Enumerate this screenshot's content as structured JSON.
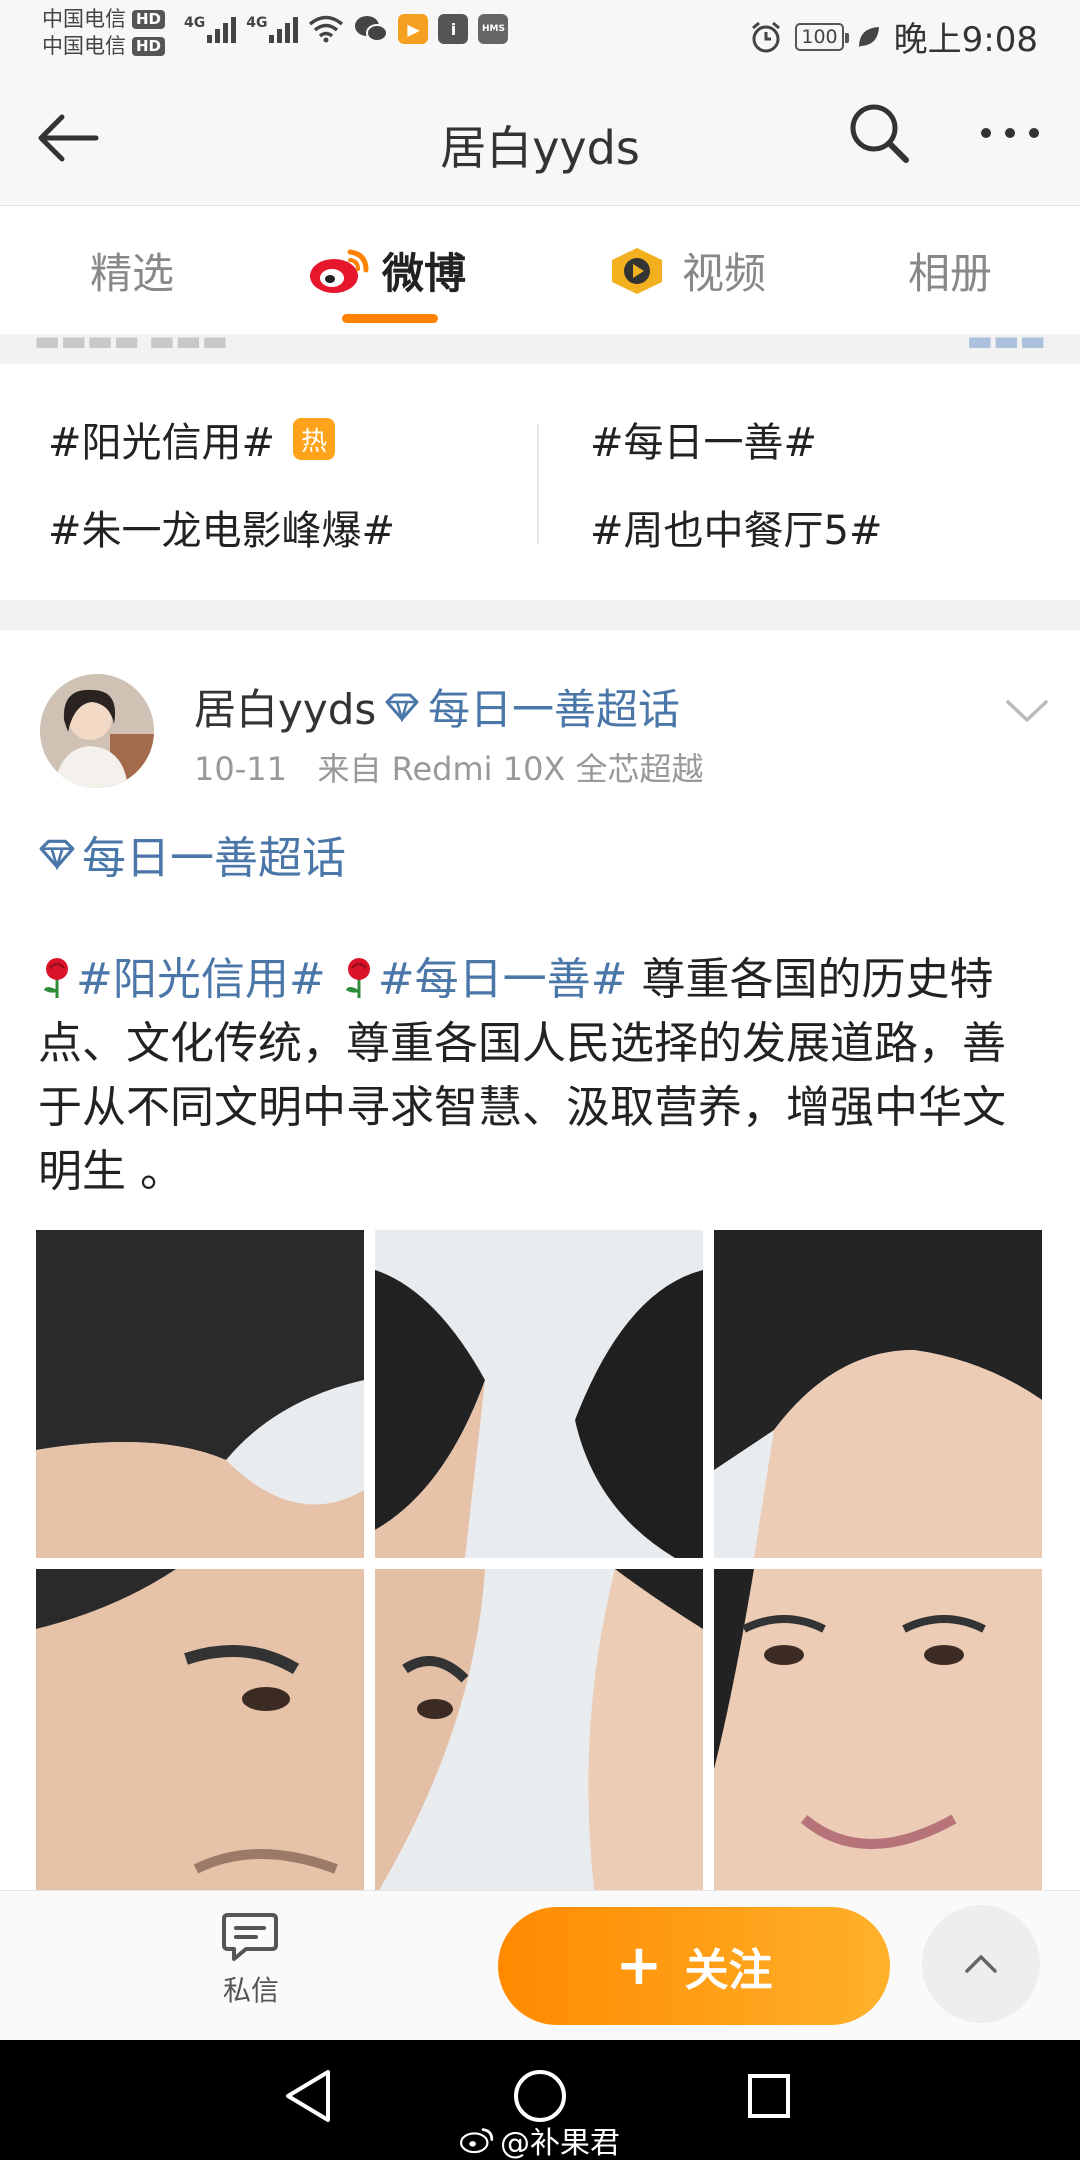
{
  "status_bar": {
    "carrier_1": "中国电信",
    "carrier_2": "中国电信",
    "hd_badge": "HD",
    "network_label": "4G",
    "hms_label": "HMS",
    "battery": "100",
    "time": "晚上9:08"
  },
  "header": {
    "title": "居白yyds"
  },
  "tabs": [
    {
      "label": "精选",
      "active": false
    },
    {
      "label": "微博",
      "active": true
    },
    {
      "label": "视频",
      "active": false
    },
    {
      "label": "相册",
      "active": false
    }
  ],
  "topics": {
    "items": [
      "#阳光信用#",
      "#每日一善#",
      "#朱一龙电影峰爆#",
      "#周也中餐厅5#"
    ],
    "hot_badge": "热"
  },
  "post": {
    "author": "居白yyds",
    "author_supertopic": "每日一善超话",
    "date": "10-11",
    "source": "来自 Redmi 10X 全芯超越",
    "supertopic_link": "每日一善超话",
    "tag_1": "#阳光信用#",
    "tag_2": "#每日一善#",
    "body_text": " 尊重各国的历史特点、文化传统，尊重各国人民选择的发展道路，善于从不同文明中寻求智慧、汲取营养，增强中华文明生 。",
    "image_count": 6
  },
  "bottom_bar": {
    "dm_label": "私信",
    "follow_label": "关注"
  },
  "nav_watermark": "@补果君",
  "colors": {
    "accent_orange": "#ff8200",
    "link_blue": "#4a76a8",
    "hot_badge": "#ffa31a"
  }
}
